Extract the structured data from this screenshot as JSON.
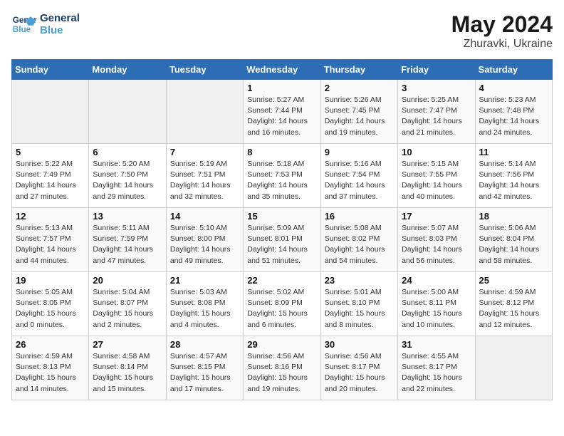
{
  "header": {
    "logo_line1": "General",
    "logo_line2": "Blue",
    "month_year": "May 2024",
    "location": "Zhuravki, Ukraine"
  },
  "weekdays": [
    "Sunday",
    "Monday",
    "Tuesday",
    "Wednesday",
    "Thursday",
    "Friday",
    "Saturday"
  ],
  "weeks": [
    [
      {
        "day": "",
        "info": ""
      },
      {
        "day": "",
        "info": ""
      },
      {
        "day": "",
        "info": ""
      },
      {
        "day": "1",
        "info": "Sunrise: 5:27 AM\nSunset: 7:44 PM\nDaylight: 14 hours\nand 16 minutes."
      },
      {
        "day": "2",
        "info": "Sunrise: 5:26 AM\nSunset: 7:45 PM\nDaylight: 14 hours\nand 19 minutes."
      },
      {
        "day": "3",
        "info": "Sunrise: 5:25 AM\nSunset: 7:47 PM\nDaylight: 14 hours\nand 21 minutes."
      },
      {
        "day": "4",
        "info": "Sunrise: 5:23 AM\nSunset: 7:48 PM\nDaylight: 14 hours\nand 24 minutes."
      }
    ],
    [
      {
        "day": "5",
        "info": "Sunrise: 5:22 AM\nSunset: 7:49 PM\nDaylight: 14 hours\nand 27 minutes."
      },
      {
        "day": "6",
        "info": "Sunrise: 5:20 AM\nSunset: 7:50 PM\nDaylight: 14 hours\nand 29 minutes."
      },
      {
        "day": "7",
        "info": "Sunrise: 5:19 AM\nSunset: 7:51 PM\nDaylight: 14 hours\nand 32 minutes."
      },
      {
        "day": "8",
        "info": "Sunrise: 5:18 AM\nSunset: 7:53 PM\nDaylight: 14 hours\nand 35 minutes."
      },
      {
        "day": "9",
        "info": "Sunrise: 5:16 AM\nSunset: 7:54 PM\nDaylight: 14 hours\nand 37 minutes."
      },
      {
        "day": "10",
        "info": "Sunrise: 5:15 AM\nSunset: 7:55 PM\nDaylight: 14 hours\nand 40 minutes."
      },
      {
        "day": "11",
        "info": "Sunrise: 5:14 AM\nSunset: 7:56 PM\nDaylight: 14 hours\nand 42 minutes."
      }
    ],
    [
      {
        "day": "12",
        "info": "Sunrise: 5:13 AM\nSunset: 7:57 PM\nDaylight: 14 hours\nand 44 minutes."
      },
      {
        "day": "13",
        "info": "Sunrise: 5:11 AM\nSunset: 7:59 PM\nDaylight: 14 hours\nand 47 minutes."
      },
      {
        "day": "14",
        "info": "Sunrise: 5:10 AM\nSunset: 8:00 PM\nDaylight: 14 hours\nand 49 minutes."
      },
      {
        "day": "15",
        "info": "Sunrise: 5:09 AM\nSunset: 8:01 PM\nDaylight: 14 hours\nand 51 minutes."
      },
      {
        "day": "16",
        "info": "Sunrise: 5:08 AM\nSunset: 8:02 PM\nDaylight: 14 hours\nand 54 minutes."
      },
      {
        "day": "17",
        "info": "Sunrise: 5:07 AM\nSunset: 8:03 PM\nDaylight: 14 hours\nand 56 minutes."
      },
      {
        "day": "18",
        "info": "Sunrise: 5:06 AM\nSunset: 8:04 PM\nDaylight: 14 hours\nand 58 minutes."
      }
    ],
    [
      {
        "day": "19",
        "info": "Sunrise: 5:05 AM\nSunset: 8:05 PM\nDaylight: 15 hours\nand 0 minutes."
      },
      {
        "day": "20",
        "info": "Sunrise: 5:04 AM\nSunset: 8:07 PM\nDaylight: 15 hours\nand 2 minutes."
      },
      {
        "day": "21",
        "info": "Sunrise: 5:03 AM\nSunset: 8:08 PM\nDaylight: 15 hours\nand 4 minutes."
      },
      {
        "day": "22",
        "info": "Sunrise: 5:02 AM\nSunset: 8:09 PM\nDaylight: 15 hours\nand 6 minutes."
      },
      {
        "day": "23",
        "info": "Sunrise: 5:01 AM\nSunset: 8:10 PM\nDaylight: 15 hours\nand 8 minutes."
      },
      {
        "day": "24",
        "info": "Sunrise: 5:00 AM\nSunset: 8:11 PM\nDaylight: 15 hours\nand 10 minutes."
      },
      {
        "day": "25",
        "info": "Sunrise: 4:59 AM\nSunset: 8:12 PM\nDaylight: 15 hours\nand 12 minutes."
      }
    ],
    [
      {
        "day": "26",
        "info": "Sunrise: 4:59 AM\nSunset: 8:13 PM\nDaylight: 15 hours\nand 14 minutes."
      },
      {
        "day": "27",
        "info": "Sunrise: 4:58 AM\nSunset: 8:14 PM\nDaylight: 15 hours\nand 15 minutes."
      },
      {
        "day": "28",
        "info": "Sunrise: 4:57 AM\nSunset: 8:15 PM\nDaylight: 15 hours\nand 17 minutes."
      },
      {
        "day": "29",
        "info": "Sunrise: 4:56 AM\nSunset: 8:16 PM\nDaylight: 15 hours\nand 19 minutes."
      },
      {
        "day": "30",
        "info": "Sunrise: 4:56 AM\nSunset: 8:17 PM\nDaylight: 15 hours\nand 20 minutes."
      },
      {
        "day": "31",
        "info": "Sunrise: 4:55 AM\nSunset: 8:17 PM\nDaylight: 15 hours\nand 22 minutes."
      },
      {
        "day": "",
        "info": ""
      }
    ]
  ]
}
